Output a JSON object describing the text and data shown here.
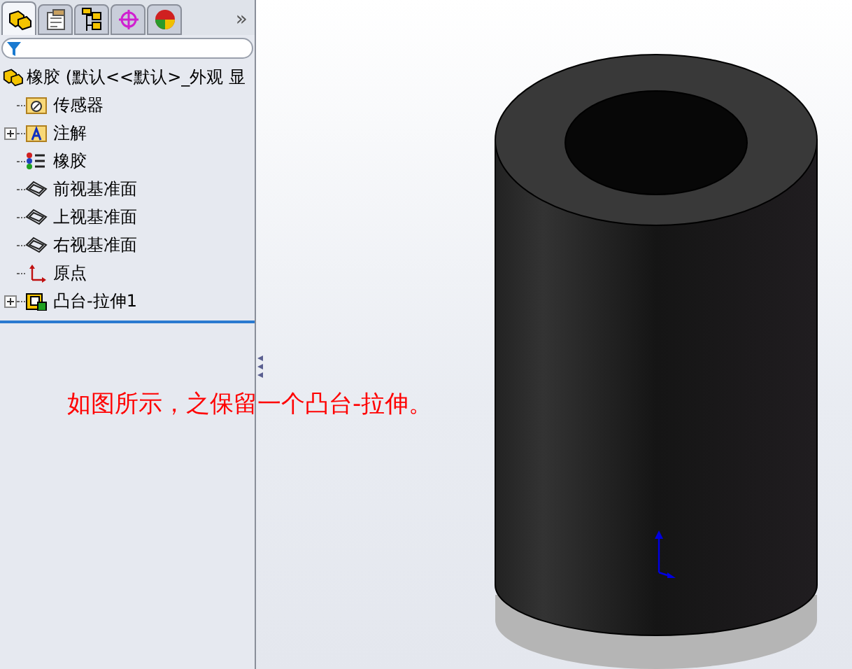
{
  "panel": {
    "tabs": [
      {
        "kind": "features",
        "selected": true
      },
      {
        "kind": "properties",
        "selected": false
      },
      {
        "kind": "configurations",
        "selected": false
      },
      {
        "kind": "dimxpert",
        "selected": false
      },
      {
        "kind": "display",
        "selected": false
      }
    ],
    "more": "»",
    "tree": {
      "label": "橡胶  (默认<<默认>_外观 显",
      "kind": "part",
      "children": [
        {
          "label": "传感器",
          "kind": "sensor",
          "expandable": false
        },
        {
          "label": "注解",
          "kind": "annotation",
          "expandable": true
        },
        {
          "label": "橡胶",
          "kind": "material",
          "expandable": false
        },
        {
          "label": "前视基准面",
          "kind": "plane",
          "expandable": false
        },
        {
          "label": "上视基准面",
          "kind": "plane",
          "expandable": false
        },
        {
          "label": "右视基准面",
          "kind": "plane",
          "expandable": false
        },
        {
          "label": "原点",
          "kind": "origin",
          "expandable": false
        },
        {
          "label": "凸台-拉伸1",
          "kind": "extrude",
          "expandable": true
        }
      ]
    }
  },
  "note": "如图所示，之保留一个凸台-拉伸。"
}
